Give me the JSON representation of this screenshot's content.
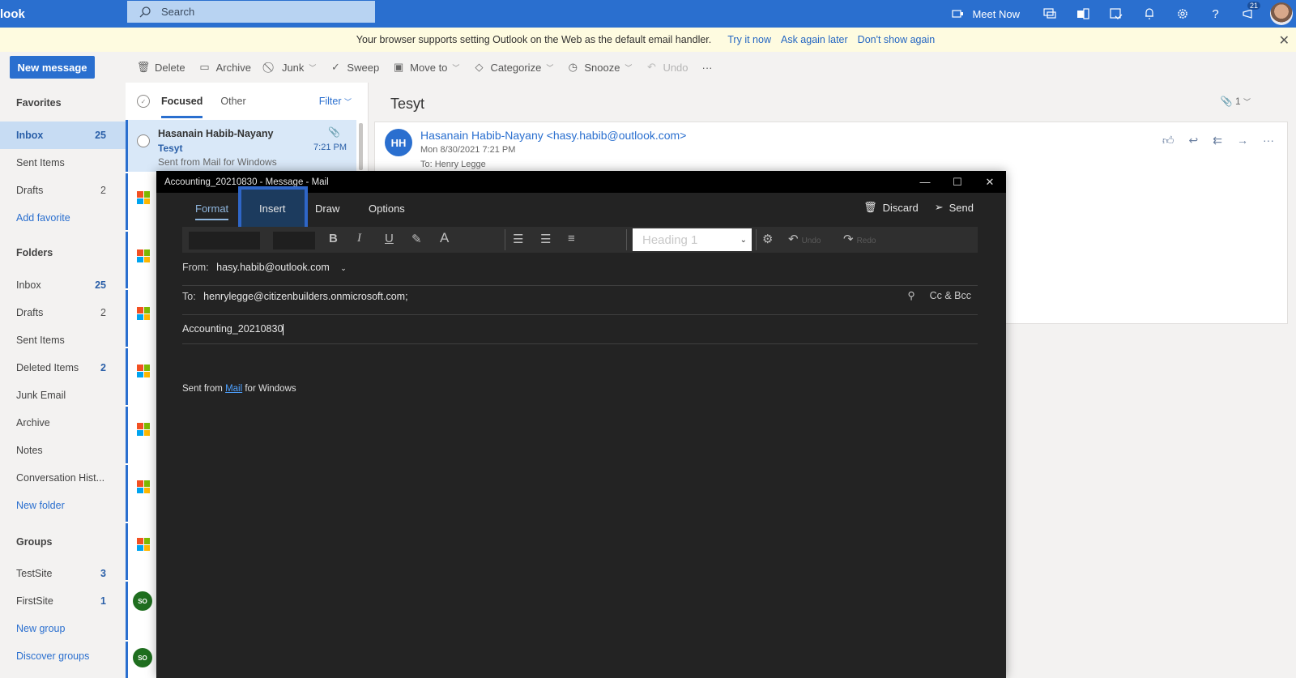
{
  "topbar": {
    "brand": "look",
    "search_placeholder": "Search",
    "meet_now": "Meet Now",
    "notification_count": "21",
    "icons": [
      "video-icon",
      "skype-icon",
      "office-icon",
      "calendar-check-icon",
      "bell-icon",
      "gear-icon",
      "help-icon",
      "megaphone-icon"
    ]
  },
  "banner": {
    "message": "Your browser supports setting Outlook on the Web as the default email handler.",
    "links": [
      "Try it now",
      "Ask again later",
      "Don't show again"
    ]
  },
  "commandbar": {
    "new_message": "New message",
    "commands": [
      {
        "label": "Delete",
        "icon": "trash-icon"
      },
      {
        "label": "Archive",
        "icon": "archive-icon"
      },
      {
        "label": "Junk",
        "icon": "block-icon",
        "dropdown": true
      },
      {
        "label": "Sweep",
        "icon": "broom-icon"
      },
      {
        "label": "Move to",
        "icon": "folder-move-icon",
        "dropdown": true
      },
      {
        "label": "Categorize",
        "icon": "tag-icon",
        "dropdown": true
      },
      {
        "label": "Snooze",
        "icon": "clock-icon",
        "dropdown": true
      },
      {
        "label": "Undo",
        "icon": "undo-icon",
        "disabled": true
      }
    ],
    "more": "···"
  },
  "leftnav": {
    "favorites_header": "Favorites",
    "favorites": [
      {
        "label": "Inbox",
        "count": "25",
        "selected": true
      },
      {
        "label": "Sent Items",
        "count": ""
      },
      {
        "label": "Drafts",
        "count": "2"
      }
    ],
    "add_favorite": "Add favorite",
    "folders_header": "Folders",
    "folders": [
      {
        "label": "Inbox",
        "count": "25"
      },
      {
        "label": "Drafts",
        "count": "2"
      },
      {
        "label": "Sent Items",
        "count": ""
      },
      {
        "label": "Deleted Items",
        "count": "2"
      },
      {
        "label": "Junk Email",
        "count": ""
      },
      {
        "label": "Archive",
        "count": ""
      },
      {
        "label": "Notes",
        "count": ""
      },
      {
        "label": "Conversation Hist...",
        "count": ""
      }
    ],
    "new_folder": "New folder",
    "groups_header": "Groups",
    "groups": [
      {
        "label": "TestSite",
        "count": "3"
      },
      {
        "label": "FirstSite",
        "count": "1"
      }
    ],
    "new_group": "New group",
    "discover_groups": "Discover groups"
  },
  "messagelist": {
    "tabs": [
      "Focused",
      "Other"
    ],
    "active_tab": "Focused",
    "filter": "Filter",
    "selected_message": {
      "from": "Hasanain Habib-Nayany",
      "subject": "Tesyt",
      "preview": "Sent from Mail for Windows",
      "time": "7:21 PM",
      "has_attachment": true
    },
    "avatar_initials": "SO"
  },
  "reading": {
    "subject": "Tesyt",
    "attachment_count": "1",
    "avatar_initials": "HH",
    "from": "Hasanain Habib-Nayany <hasy.habib@outlook.com>",
    "date": "Mon 8/30/2021 7:21 PM",
    "to": "To:  Henry Legge",
    "actions": [
      "like-icon",
      "reply-icon",
      "reply-all-icon",
      "forward-icon",
      "more-icon"
    ]
  },
  "compose": {
    "window_title": "Accounting_20210830 - Message - Mail",
    "tabs": [
      "Format",
      "Insert",
      "Draw",
      "Options"
    ],
    "active_tab": "Format",
    "highlighted_tab": "Insert",
    "discard": "Discard",
    "send": "Send",
    "style_select": "Heading 1",
    "undo": "Undo",
    "redo": "Redo",
    "from_label": "From:",
    "from_value": "hasy.habib@outlook.com",
    "to_label": "To:",
    "to_value": "henrylegge@citizenbuilders.onmicrosoft.com;",
    "cc_bcc": "Cc & Bcc",
    "subject": "Accounting_20210830",
    "signature_pre": "Sent from ",
    "signature_link": "Mail",
    "signature_post": " for Windows"
  }
}
